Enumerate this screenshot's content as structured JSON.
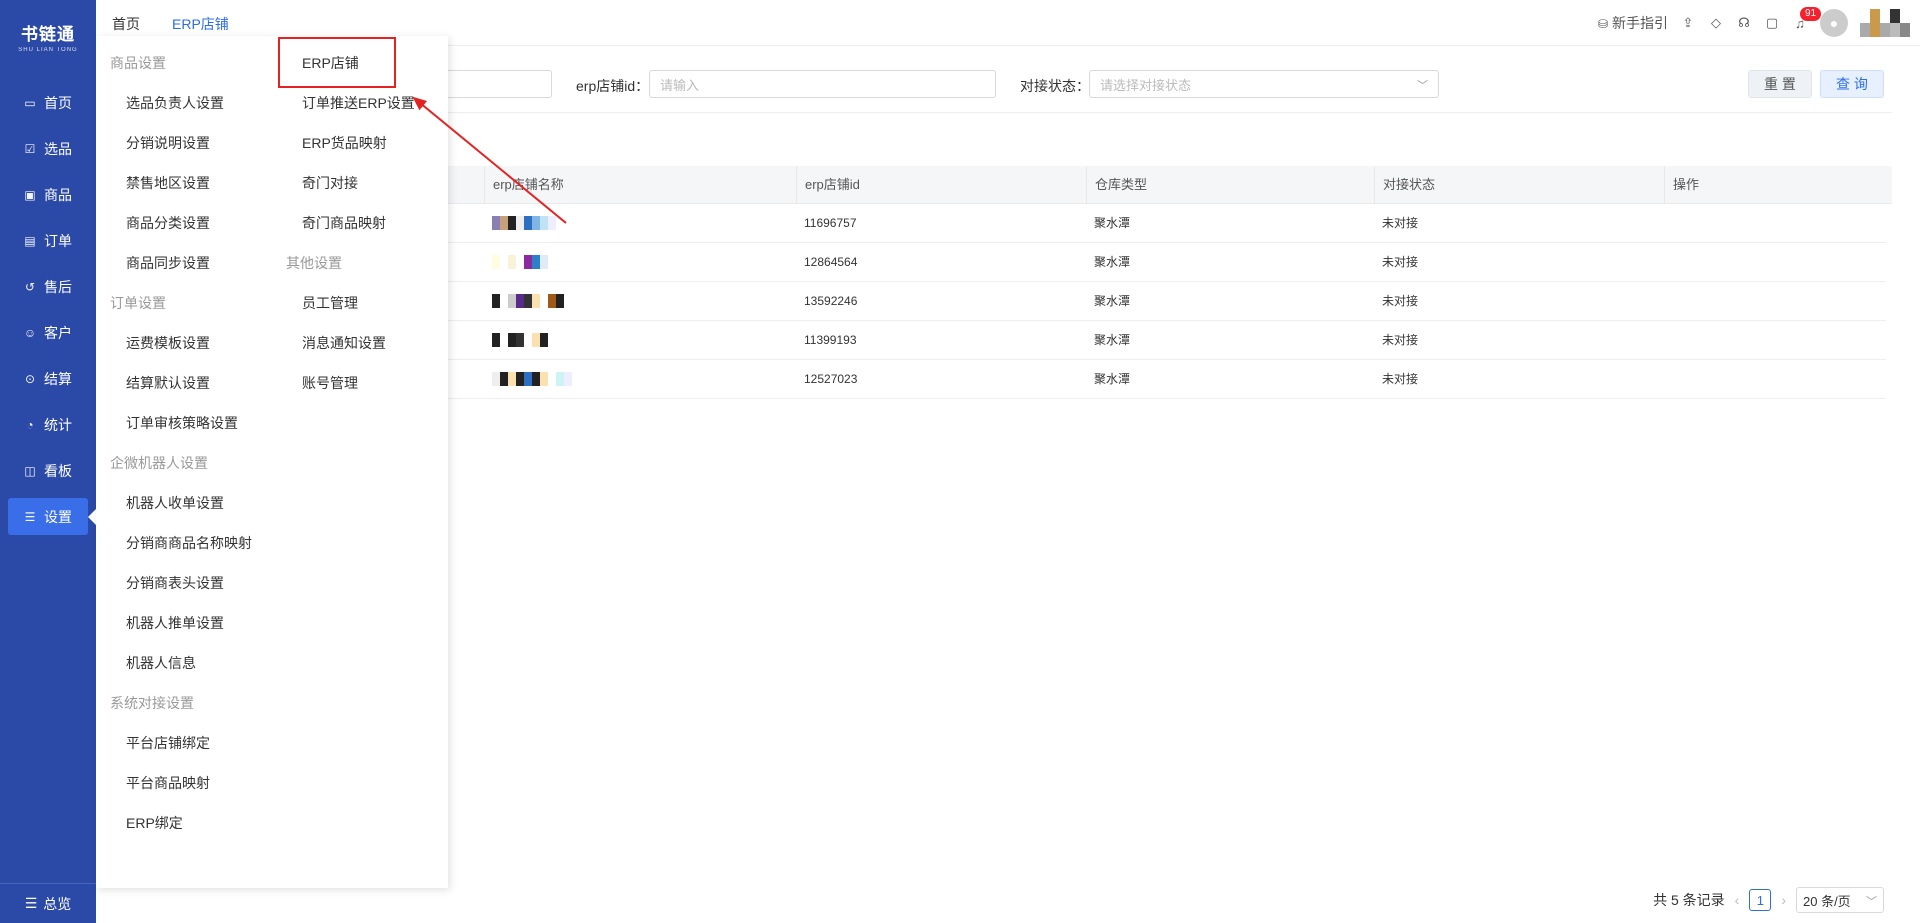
{
  "app": {
    "logo_main": "书链通",
    "logo_sub": "SHU LIAN TONG",
    "nav": [
      {
        "label": "首页",
        "icon": "monitor-icon"
      },
      {
        "label": "选品",
        "icon": "list-check-icon"
      },
      {
        "label": "商品",
        "icon": "box-icon"
      },
      {
        "label": "订单",
        "icon": "document-icon"
      },
      {
        "label": "售后",
        "icon": "refresh-icon"
      },
      {
        "label": "客户",
        "icon": "users-icon"
      },
      {
        "label": "结算",
        "icon": "settle-icon"
      },
      {
        "label": "统计",
        "icon": "pie-icon"
      },
      {
        "label": "看板",
        "icon": "dashboard-icon"
      },
      {
        "label": "设置",
        "icon": "sliders-icon"
      }
    ],
    "active_nav": "设置",
    "bottom_nav": "总览"
  },
  "topbar": {
    "breadcrumb_home": "首页",
    "breadcrumb_current": "ERP店铺",
    "guide_label": "新手指引",
    "notification_count": "91"
  },
  "filters": {
    "shop_id_label": "erp店铺id：",
    "shop_id_placeholder": "请输入",
    "status_label": "对接状态：",
    "status_placeholder": "请选择对接状态",
    "reset_label": "重 置",
    "query_label": "查 询"
  },
  "table": {
    "columns": [
      "erp店铺名称",
      "erp店铺id",
      "仓库类型",
      "对接状态",
      "操作"
    ],
    "rows": [
      {
        "shop_id": "11696757",
        "warehouse": "聚水潭",
        "status": "未对接"
      },
      {
        "shop_id": "12864564",
        "warehouse": "聚水潭",
        "status": "未对接"
      },
      {
        "shop_id": "13592246",
        "warehouse": "聚水潭",
        "status": "未对接"
      },
      {
        "shop_id": "11399193",
        "warehouse": "聚水潭",
        "status": "未对接"
      },
      {
        "shop_id": "12527023",
        "warehouse": "聚水潭",
        "status": "未对接"
      }
    ]
  },
  "menu": {
    "col1": [
      {
        "type": "group",
        "label": "商品设置"
      },
      {
        "type": "item",
        "label": "选品负责人设置"
      },
      {
        "type": "item",
        "label": "分销说明设置"
      },
      {
        "type": "item",
        "label": "禁售地区设置"
      },
      {
        "type": "item",
        "label": "商品分类设置"
      },
      {
        "type": "item",
        "label": "商品同步设置"
      },
      {
        "type": "group",
        "label": "订单设置"
      },
      {
        "type": "item",
        "label": "运费模板设置"
      },
      {
        "type": "item",
        "label": "结算默认设置"
      },
      {
        "type": "item",
        "label": "订单审核策略设置"
      },
      {
        "type": "group",
        "label": "企微机器人设置"
      },
      {
        "type": "item",
        "label": "机器人收单设置"
      },
      {
        "type": "item",
        "label": "分销商商品名称映射"
      },
      {
        "type": "item",
        "label": "分销商表头设置"
      },
      {
        "type": "item",
        "label": "机器人推单设置"
      },
      {
        "type": "item",
        "label": "机器人信息"
      },
      {
        "type": "group",
        "label": "系统对接设置"
      },
      {
        "type": "item",
        "label": "平台店铺绑定"
      },
      {
        "type": "item",
        "label": "平台商品映射"
      },
      {
        "type": "item",
        "label": "ERP绑定"
      }
    ],
    "col2": [
      {
        "type": "item",
        "label": "ERP店铺"
      },
      {
        "type": "item",
        "label": "订单推送ERP设置"
      },
      {
        "type": "item",
        "label": "ERP货品映射"
      },
      {
        "type": "item",
        "label": "奇门对接"
      },
      {
        "type": "item",
        "label": "奇门商品映射"
      },
      {
        "type": "group",
        "label": "其他设置"
      },
      {
        "type": "item",
        "label": "员工管理"
      },
      {
        "type": "item",
        "label": "消息通知设置"
      },
      {
        "type": "item",
        "label": "账号管理"
      }
    ]
  },
  "pagination": {
    "total_label": "共 5 条记录",
    "current_page": "1",
    "page_size": "20 条/页"
  },
  "colors": {
    "sidebar": "#2b4aa8",
    "active": "#3a6ee8",
    "accent": "#2d6ee8",
    "annotation": "#e52222"
  }
}
